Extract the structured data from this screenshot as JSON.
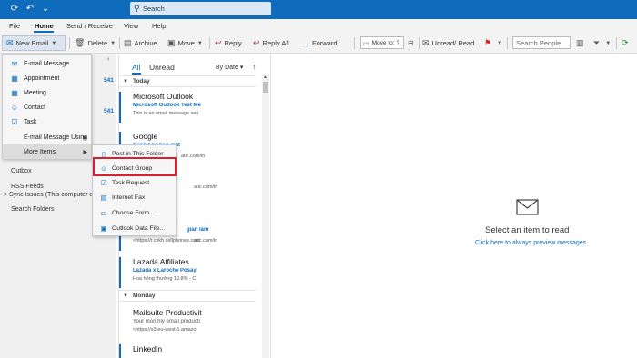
{
  "window": {
    "search_placeholder": "Search",
    "icons": [
      "sync-icon",
      "undo-icon",
      "customize-icon",
      "search-icon"
    ]
  },
  "tabs": [
    "File",
    "Home",
    "Send / Receive",
    "View",
    "Help"
  ],
  "active_tab": "Home",
  "ribbon": {
    "new_email": "New Email",
    "delete": "Delete",
    "archive": "Archive",
    "move": "Move",
    "reply": "Reply",
    "reply_all": "Reply All",
    "forward": "Forward",
    "move_to": "Move to: ?",
    "unread_read": "Unread/ Read",
    "search_people": "Search People"
  },
  "new_items_menu": [
    {
      "label": "E-mail Message",
      "icon": "mail-icon"
    },
    {
      "label": "Appointment",
      "icon": "calendar-icon"
    },
    {
      "label": "Meeting",
      "icon": "meeting-icon"
    },
    {
      "label": "Contact",
      "icon": "contact-icon"
    },
    {
      "label": "Task",
      "icon": "task-icon"
    },
    {
      "label": "E-mail Message Using",
      "icon": "",
      "submenu": true
    },
    {
      "label": "More Items",
      "icon": "",
      "submenu": true
    }
  ],
  "more_items_submenu": [
    {
      "label": "Post in This Folder",
      "icon": "post-icon"
    },
    {
      "label": "Contact Group",
      "icon": "contact-group-icon"
    },
    {
      "label": "Task Request",
      "icon": "task-request-icon"
    },
    {
      "label": "Internet Fax",
      "icon": "fax-icon"
    },
    {
      "label": "Choose Form...",
      "icon": "form-icon"
    },
    {
      "label": "Outlook Data File...",
      "icon": "data-file-icon"
    }
  ],
  "folders": [
    "Outbox",
    "RSS Feeds",
    "> Sync Issues (This computer on",
    "Search Folders"
  ],
  "unread_counts": [
    "541",
    "541"
  ],
  "message_list": {
    "filter_all": "All",
    "filter_unread": "Unread",
    "sort": "By Date",
    "groups": {
      "today": "Today",
      "monday": "Monday"
    },
    "messages": [
      {
        "from": "Microsoft Outlook",
        "subject": "Microsoft Outlook Test Me",
        "preview": "This is an email message sen"
      },
      {
        "from": "Google",
        "subject": "Cảnh báo bảo mật",
        "preview": "atic.com/in"
      },
      {
        "from": "",
        "subject": "gian làm",
        "preview": "<https://r.cskh.cellphones.com"
      },
      {
        "from": "Lazada Affiliates",
        "subject": "Lazada x Laroche Posay",
        "preview": "Hoa hồng thưởng 10.8% - C"
      },
      {
        "from": "Mailsuite Productivit",
        "subject": "Your monthly email producti",
        "preview": "<https://s3-eu-west-1.amazo"
      },
      {
        "from": "LinkedIn",
        "subject": "",
        "preview": ""
      }
    ],
    "partial_previews": [
      "atic.com/in",
      "atic.com/in"
    ]
  },
  "reading_pane": {
    "title": "Select an item to read",
    "link": "Click here to always preview messages"
  },
  "colors": {
    "accent": "#0f6cbd",
    "highlight": "#d8202f"
  }
}
